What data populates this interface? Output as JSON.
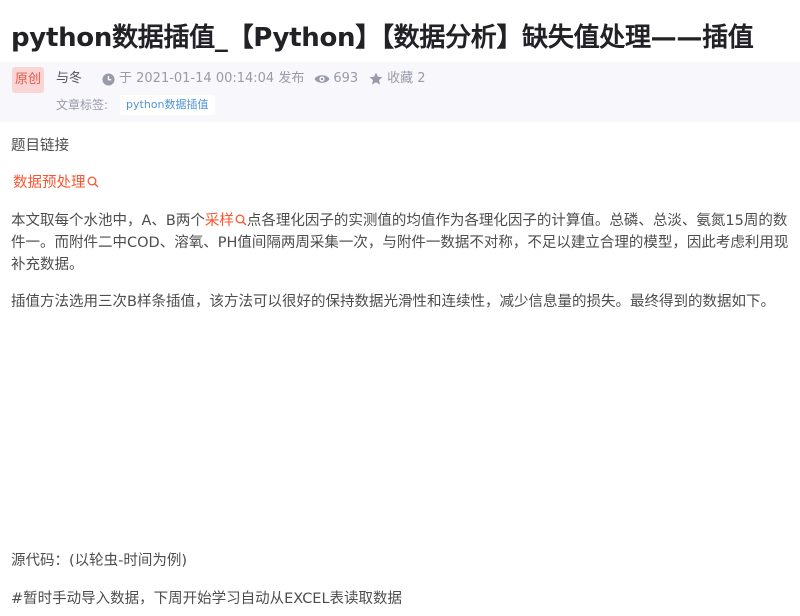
{
  "article": {
    "title": "python数据插值_【Python】【数据分析】缺失值处理——插值"
  },
  "meta": {
    "badge": "原创",
    "author": "与冬",
    "published": "于 2021-01-14 00:14:04 发布",
    "views": "693",
    "favorites": "收藏 2",
    "tags_label": "文章标签:",
    "tags": [
      "python数据插值"
    ]
  },
  "content": {
    "p1": "题目链接",
    "link1": "数据预处理",
    "p3_prefix": "本文取每个水池中，A、B两个",
    "p3_link": "采样",
    "p3_suffix": "点各理化因子的实测值的均值作为各理化因子的计算值。总磷、总淡、氨氮15周的数",
    "p3_line2": "件一。而附件二中COD、溶氧、PH值间隔两周采集一次，与附件一数据不对称，不足以建立合理的模型，因此考虑利用现",
    "p3_line3": "补充数据。",
    "p4": "插值方法选用三次B样条插值，该方法可以很好的保持数据光滑性和连续性，减少信息量的损失。最终得到的数据如下。",
    "p5": "源代码：(以轮虫-时间为例)",
    "p6": "#暂时手动导入数据，下周开始学习自动从EXCEL表读取数据"
  },
  "colors": {
    "link": "#fc5531",
    "badge_bg": "#f9d6d3",
    "badge_text": "#e05a4f",
    "meta_bg": "#f7f7fc",
    "tag_text": "#5094d5"
  },
  "icons": {
    "time": "clock-icon",
    "views": "eye-icon",
    "favorites": "star-icon",
    "search": "search-icon"
  }
}
